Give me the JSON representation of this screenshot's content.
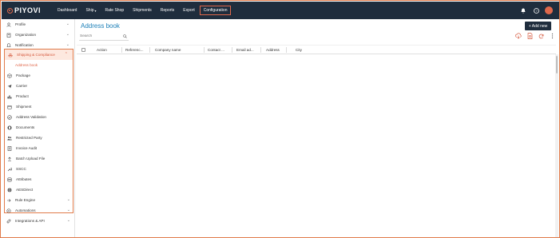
{
  "brand": {
    "name": "PIYOVI"
  },
  "nav": {
    "items": [
      {
        "label": "Dashboard"
      },
      {
        "label": "Ship",
        "has_caret": true
      },
      {
        "label": "Rate Shop"
      },
      {
        "label": "Shipments"
      },
      {
        "label": "Reports"
      },
      {
        "label": "Export"
      },
      {
        "label": "Configuration",
        "active": true
      }
    ]
  },
  "sidebar": {
    "top_items": [
      {
        "label": "Profile",
        "icon": "person-icon"
      },
      {
        "label": "Organization",
        "icon": "building-icon"
      },
      {
        "label": "Notification",
        "icon": "bell-icon"
      }
    ],
    "group": {
      "label": "Shipping & Compliance",
      "children": [
        {
          "label": "Address book",
          "active": true
        },
        {
          "label": "Package"
        },
        {
          "label": "Carrier"
        },
        {
          "label": "Product"
        },
        {
          "label": "Shipment"
        },
        {
          "label": "Address Validation"
        },
        {
          "label": "Documents"
        },
        {
          "label": "Restricted Party"
        },
        {
          "label": "Invoice Audit"
        },
        {
          "label": "Batch Upload File"
        },
        {
          "label": "SSCC"
        },
        {
          "label": "Attributes"
        },
        {
          "label": "AESDirect"
        }
      ]
    },
    "bottom_items": [
      {
        "label": "Rule Engine"
      },
      {
        "label": "Automations"
      },
      {
        "label": "Integrations & API"
      }
    ]
  },
  "main": {
    "title": "Address book",
    "add_button": "+ Add new",
    "search_placeholder": "Search",
    "columns": [
      "Action",
      "Referenc...",
      "Company name",
      "Contact ...",
      "Email ad...",
      "Address",
      "City"
    ]
  },
  "colors": {
    "accent": "#e0684b",
    "topbar": "#1f2d3d",
    "title": "#1e80b8"
  }
}
